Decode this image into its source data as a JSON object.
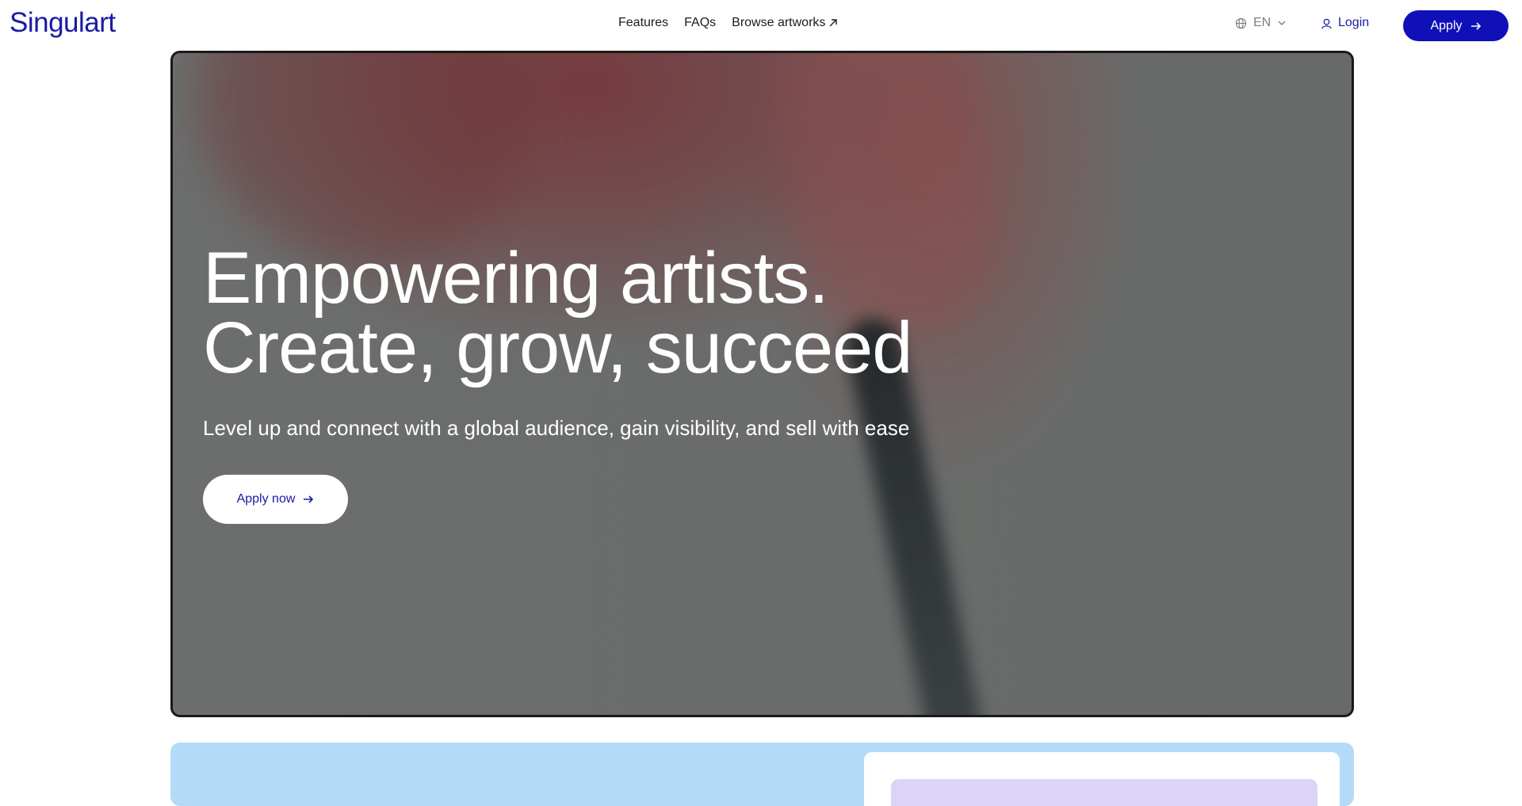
{
  "brand": {
    "logo_text": "Singulart"
  },
  "nav": {
    "links": [
      {
        "label": "Features"
      },
      {
        "label": "FAQs"
      },
      {
        "label": "Browse artworks",
        "icon": "external-link-icon"
      }
    ]
  },
  "header": {
    "language": "EN",
    "login_label": "Login",
    "apply_label": "Apply"
  },
  "hero": {
    "title_line1": "Empowering artists.",
    "title_line2": "Create, grow, succeed",
    "subtitle": "Level up and connect with a global audience, gain visibility, and sell with ease",
    "cta_label": "Apply now"
  },
  "colors": {
    "brand_blue": "#0f10b8",
    "logo_blue": "#1a1aa6",
    "section_light_blue": "#b3dbf8",
    "card_lavender": "#dcd4f6"
  }
}
